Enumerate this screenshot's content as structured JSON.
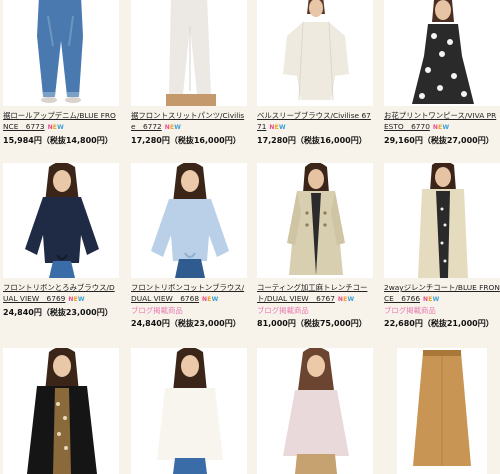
{
  "products": [
    {
      "title": "裾ロールアップデニム/BLUE FRONCE　6773",
      "new": true,
      "blog": "",
      "price": "15,984円（税抜14,800円）"
    },
    {
      "title": "裾フロントスリットパンツ/Civilise　6772",
      "new": true,
      "blog": "",
      "price": "17,280円（税抜16,000円）"
    },
    {
      "title": "ベルスリーブブラウス/Civilise 6771",
      "new": true,
      "blog": "",
      "price": "17,280円（税抜16,000円）"
    },
    {
      "title": "お花プリントワンピース/VIVA PRESTO　6770",
      "new": true,
      "blog": "",
      "price": "29,160円（税抜27,000円）"
    },
    {
      "title": "フロントリボンとろみブラウス/DUAL VIEW　6769",
      "new": true,
      "blog": "",
      "price": "24,840円（税抜23,000円）"
    },
    {
      "title": "フロントリボンコットンブラウス/DUAL VIEW　6768",
      "new": true,
      "blog": "ブログ掲載商品",
      "price": "24,840円（税抜23,000円）"
    },
    {
      "title": "コーティング加工麻トレンチコート/DUAL VIEW　6767",
      "new": true,
      "blog": "ブログ掲載商品",
      "price": "81,000円（税抜75,000円）"
    },
    {
      "title": "2wayジレンチコート/BLUE FRONCE　6766",
      "new": true,
      "blog": "ブログ掲載商品",
      "price": "22,680円（税抜21,000円）"
    }
  ],
  "new_badge": {
    "n": "N",
    "e": "E",
    "w": "W"
  }
}
